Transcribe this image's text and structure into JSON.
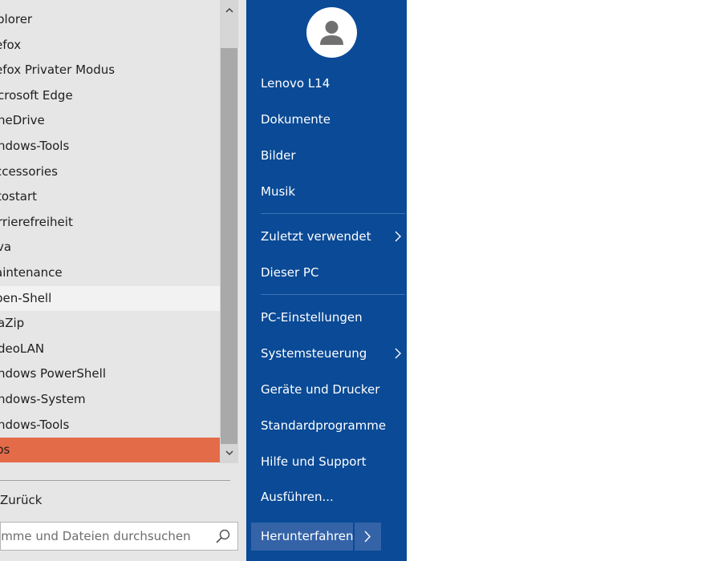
{
  "programs": [
    {
      "label": "plorer"
    },
    {
      "label": "efox"
    },
    {
      "label": "efox Privater Modus"
    },
    {
      "label": "crosoft Edge"
    },
    {
      "label": "neDrive"
    },
    {
      "label": "ndows-Tools"
    },
    {
      "label": "ccessories"
    },
    {
      "label": "tostart"
    },
    {
      "label": "rrierefreiheit"
    },
    {
      "label": "va"
    },
    {
      "label": "aintenance"
    },
    {
      "label": "pen-Shell"
    },
    {
      "label": "aZip"
    },
    {
      "label": "deoLAN"
    },
    {
      "label": "ndows PowerShell"
    },
    {
      "label": "ndows-System"
    },
    {
      "label": "ndows-Tools"
    },
    {
      "label": "ps"
    }
  ],
  "back_label": "Zurück",
  "search_placeholder": "amme und Dateien durchsuchen",
  "right_menu": {
    "items": [
      {
        "label": "Lenovo L14"
      },
      {
        "label": "Dokumente"
      },
      {
        "label": "Bilder"
      },
      {
        "label": "Musik"
      },
      {
        "label": "Zuletzt verwendet"
      },
      {
        "label": "Dieser PC"
      },
      {
        "label": "PC-Einstellungen"
      },
      {
        "label": "Systemsteuerung"
      },
      {
        "label": "Geräte und Drucker"
      },
      {
        "label": "Standardprogramme"
      },
      {
        "label": "Hilfe und Support"
      },
      {
        "label": "Ausführen..."
      }
    ],
    "shutdown_label": "Herunterfahren"
  },
  "colors": {
    "left_bg": "#e6e6e6",
    "right_bg": "#0a4a96",
    "selected": "#e46b48",
    "hover": "#f2f2f2"
  },
  "icons": [
    "scroll-up-icon",
    "scroll-down-icon",
    "search-icon",
    "user-avatar-icon",
    "chevron-right-icon"
  ]
}
